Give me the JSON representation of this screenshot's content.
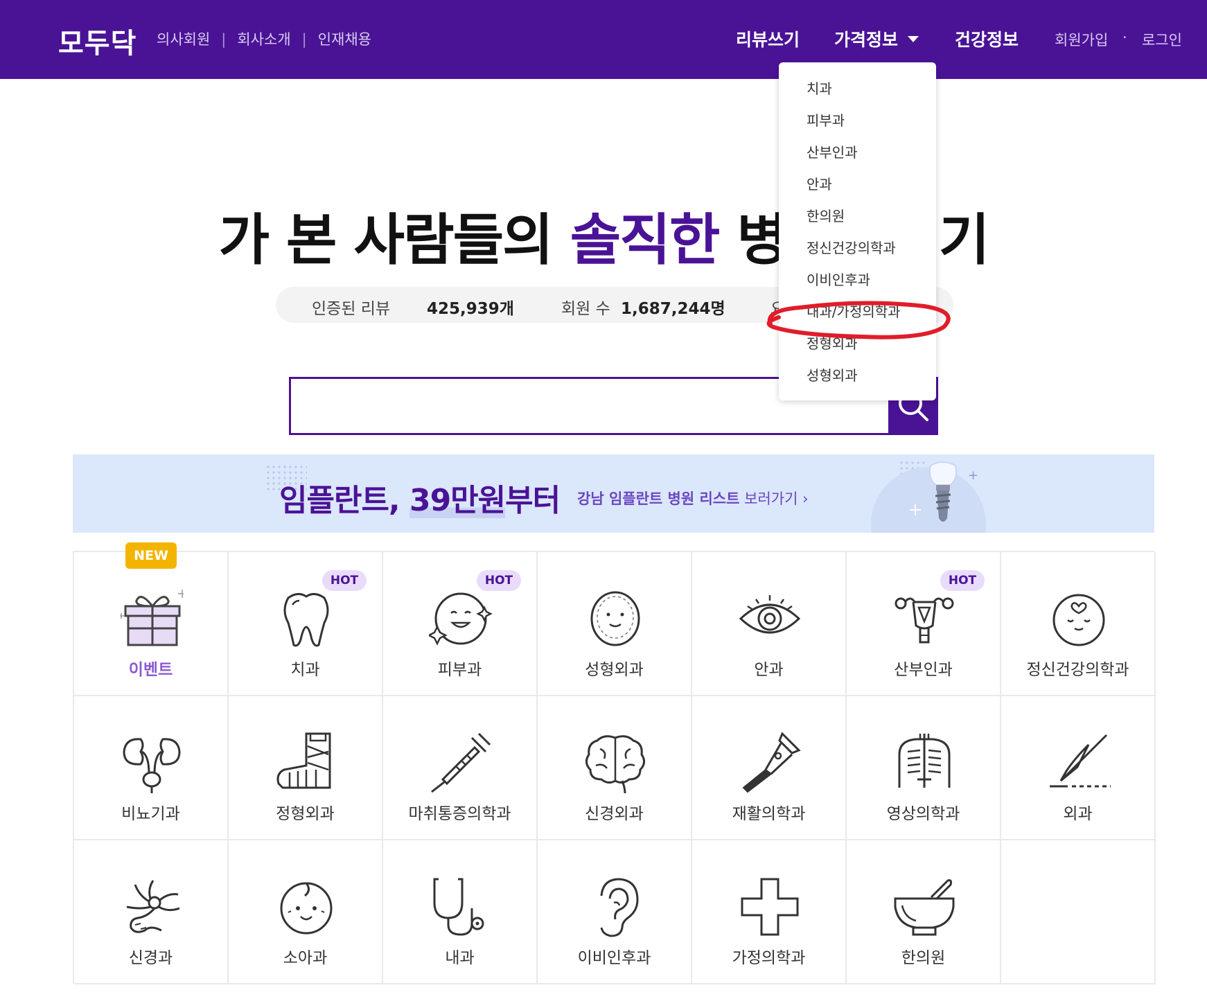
{
  "header": {
    "logo": "모두닥",
    "left_links": [
      "의사회원",
      "회사소개",
      "인재채용"
    ],
    "separator": "|",
    "nav": {
      "review": "리뷰쓰기",
      "price": "가격정보",
      "health": "건강정보"
    },
    "auth": {
      "signup": "회원가입",
      "dot": "·",
      "login": "로그인"
    }
  },
  "dropdown": {
    "items": [
      "치과",
      "피부과",
      "산부인과",
      "안과",
      "한의원",
      "정신건강의학과",
      "이비인후과",
      "내과/가정의학과",
      "정형외과",
      "성형외과"
    ]
  },
  "hero": {
    "title_before": "가 본 사람들의 ",
    "title_accent": "솔직한",
    "title_after": " 병",
    "title_end": "기"
  },
  "stats": {
    "review_label": "인증된 리뷰",
    "review_value": "425,939개",
    "member_label": "회원 수",
    "member_value": "1,687,244명",
    "partial": "요"
  },
  "search": {
    "placeholder": ""
  },
  "banner": {
    "main_1": "임플란트, ",
    "main_num": "39만원",
    "main_2": "부터",
    "sub_bold": "강남 임플란트 병원 리스트",
    "sub_rest": " 보러가기",
    "sub_arrow": "›"
  },
  "categories": [
    {
      "label": "이벤트",
      "badge": "NEW",
      "icon": "gift-icon"
    },
    {
      "label": "치과",
      "badge": "HOT",
      "icon": "tooth-icon"
    },
    {
      "label": "피부과",
      "badge": "HOT",
      "icon": "sparkle-face-icon"
    },
    {
      "label": "성형외과",
      "badge": "",
      "icon": "face-outline-icon"
    },
    {
      "label": "안과",
      "badge": "",
      "icon": "eye-icon"
    },
    {
      "label": "산부인과",
      "badge": "HOT",
      "icon": "uterus-icon"
    },
    {
      "label": "정신건강의학과",
      "badge": "",
      "icon": "heart-face-icon"
    },
    {
      "label": "비뇨기과",
      "badge": "",
      "icon": "kidney-icon"
    },
    {
      "label": "정형외과",
      "badge": "",
      "icon": "cast-icon"
    },
    {
      "label": "마취통증의학과",
      "badge": "",
      "icon": "syringe-icon"
    },
    {
      "label": "신경외과",
      "badge": "",
      "icon": "brain-icon"
    },
    {
      "label": "재활의학과",
      "badge": "",
      "icon": "crutch-icon"
    },
    {
      "label": "영상의학과",
      "badge": "",
      "icon": "xray-icon"
    },
    {
      "label": "외과",
      "badge": "",
      "icon": "scalpel-icon"
    },
    {
      "label": "신경과",
      "badge": "",
      "icon": "neuron-icon"
    },
    {
      "label": "소아과",
      "badge": "",
      "icon": "baby-icon"
    },
    {
      "label": "내과",
      "badge": "",
      "icon": "stethoscope-icon"
    },
    {
      "label": "이비인후과",
      "badge": "",
      "icon": "ear-icon"
    },
    {
      "label": "가정의학과",
      "badge": "",
      "icon": "cross-icon"
    },
    {
      "label": "한의원",
      "badge": "",
      "icon": "mortar-icon"
    }
  ],
  "colors": {
    "brand": "#4a1396",
    "badge_hot_bg": "#e9dcfb",
    "badge_new_bg": "#f3b400",
    "annotation": "#e01d2a"
  }
}
